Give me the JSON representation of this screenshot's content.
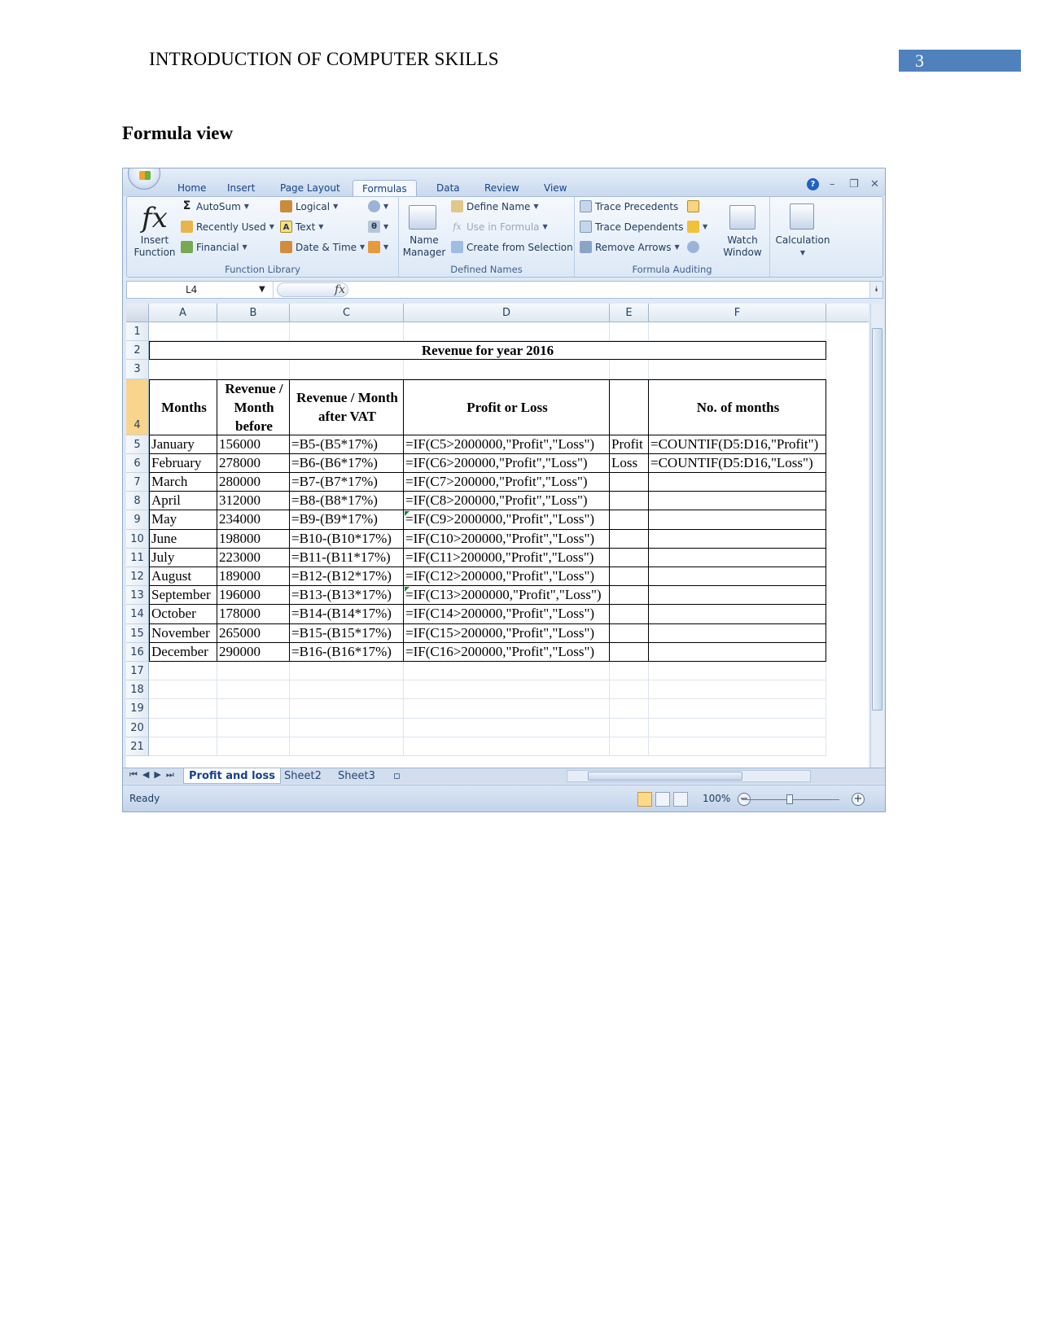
{
  "doc": {
    "header_title": "INTRODUCTION OF COMPUTER SKILLS",
    "page_number": "3",
    "section_heading": "Formula view"
  },
  "excel": {
    "tabs": [
      "Home",
      "Insert",
      "Page Layout",
      "Formulas",
      "Data",
      "Review",
      "View"
    ],
    "active_tab": "Formulas",
    "ribbon": {
      "function_library": {
        "label": "Function Library",
        "insert_function_l1": "Insert",
        "insert_function_l2": "Function",
        "autosum": "AutoSum",
        "recently_used": "Recently Used",
        "financial": "Financial",
        "logical": "Logical",
        "text": "Text",
        "date_time": "Date & Time"
      },
      "defined_names": {
        "label": "Defined Names",
        "name_manager_l1": "Name",
        "name_manager_l2": "Manager",
        "define_name": "Define Name",
        "use_in_formula": "Use in Formula",
        "create_from_selection": "Create from Selection"
      },
      "formula_auditing": {
        "label": "Formula Auditing",
        "trace_precedents": "Trace Precedents",
        "trace_dependents": "Trace Dependents",
        "remove_arrows": "Remove Arrows",
        "watch_window_l1": "Watch",
        "watch_window_l2": "Window"
      },
      "calculation": {
        "label": "Calculation"
      }
    },
    "name_box": "L4",
    "fx_symbol": "fx",
    "columns": [
      "A",
      "B",
      "C",
      "D",
      "E",
      "F"
    ],
    "row_numbers": [
      "1",
      "2",
      "3",
      "4",
      "5",
      "6",
      "7",
      "8",
      "9",
      "10",
      "11",
      "12",
      "13",
      "14",
      "15",
      "16",
      "17",
      "18",
      "19",
      "20",
      "21"
    ],
    "sheet_title": "Revenue for year 2016",
    "headers": {
      "months": "Months",
      "rev_before": "Revenue / Month before",
      "rev_after": "Revenue / Month after VAT",
      "profit_loss": "Profit or Loss",
      "no_months": "No. of months"
    },
    "rows": [
      {
        "month": "January",
        "revenue": "156000",
        "after_vat": "=B5-(B5*17%)",
        "profit": "=IF(C5>2000000,\"Profit\",\"Loss\")",
        "e": "Profit",
        "f": "=COUNTIF(D5:D16,\"Profit\")"
      },
      {
        "month": "February",
        "revenue": "278000",
        "after_vat": "=B6-(B6*17%)",
        "profit": "=IF(C6>200000,\"Profit\",\"Loss\")",
        "e": "Loss",
        "f": "=COUNTIF(D5:D16,\"Loss\")"
      },
      {
        "month": "March",
        "revenue": "280000",
        "after_vat": "=B7-(B7*17%)",
        "profit": "=IF(C7>200000,\"Profit\",\"Loss\")",
        "e": "",
        "f": ""
      },
      {
        "month": "April",
        "revenue": "312000",
        "after_vat": "=B8-(B8*17%)",
        "profit": "=IF(C8>200000,\"Profit\",\"Loss\")",
        "e": "",
        "f": ""
      },
      {
        "month": "May",
        "revenue": "234000",
        "after_vat": "=B9-(B9*17%)",
        "profit": "=IF(C9>2000000,\"Profit\",\"Loss\")",
        "e": "",
        "f": ""
      },
      {
        "month": "June",
        "revenue": "198000",
        "after_vat": "=B10-(B10*17%)",
        "profit": "=IF(C10>200000,\"Profit\",\"Loss\")",
        "e": "",
        "f": ""
      },
      {
        "month": "July",
        "revenue": "223000",
        "after_vat": "=B11-(B11*17%)",
        "profit": "=IF(C11>200000,\"Profit\",\"Loss\")",
        "e": "",
        "f": ""
      },
      {
        "month": "August",
        "revenue": "189000",
        "after_vat": "=B12-(B12*17%)",
        "profit": "=IF(C12>200000,\"Profit\",\"Loss\")",
        "e": "",
        "f": ""
      },
      {
        "month": "September",
        "revenue": "196000",
        "after_vat": "=B13-(B13*17%)",
        "profit": "=IF(C13>2000000,\"Profit\",\"Loss\")",
        "e": "",
        "f": ""
      },
      {
        "month": "October",
        "revenue": "178000",
        "after_vat": "=B14-(B14*17%)",
        "profit": "=IF(C14>200000,\"Profit\",\"Loss\")",
        "e": "",
        "f": ""
      },
      {
        "month": "November",
        "revenue": "265000",
        "after_vat": "=B15-(B15*17%)",
        "profit": "=IF(C15>200000,\"Profit\",\"Loss\")",
        "e": "",
        "f": ""
      },
      {
        "month": "December",
        "revenue": "290000",
        "after_vat": "=B16-(B16*17%)",
        "profit": "=IF(C16>200000,\"Profit\",\"Loss\")",
        "e": "",
        "f": ""
      }
    ],
    "sheet_tabs": [
      "Profit and loss",
      "Sheet2",
      "Sheet3"
    ],
    "active_sheet": "Profit and loss",
    "status": "Ready",
    "zoom": "100%",
    "colors": {
      "accent": "#4f81bd",
      "ribbon_text": "#15428b",
      "selected_row_header": "#f9d48b"
    }
  }
}
